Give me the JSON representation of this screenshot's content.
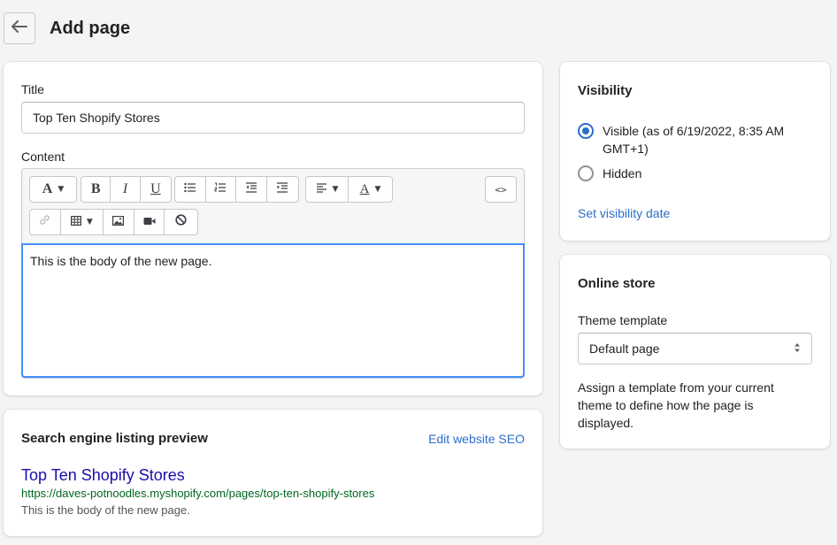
{
  "header": {
    "back_icon": "arrow-left-icon",
    "title": "Add page"
  },
  "page_form": {
    "title_label": "Title",
    "title_value": "Top Ten Shopify Stores",
    "content_label": "Content",
    "content_value": "This is the body of the new page.",
    "toolbar": {
      "row1": [
        {
          "group": "font",
          "items": [
            "text-style-icon"
          ],
          "caret": true
        },
        {
          "group": "format",
          "items": [
            "bold-icon",
            "italic-icon",
            "underline-icon"
          ]
        },
        {
          "group": "lists",
          "items": [
            "bulleted-list-icon",
            "numbered-list-icon",
            "outdent-icon",
            "indent-icon"
          ]
        },
        {
          "group": "align",
          "items": [
            "align-left-icon",
            "text-color-icon"
          ],
          "caret": true
        },
        {
          "group": "source",
          "items": [
            "html-source-icon"
          ]
        }
      ],
      "row2": [
        {
          "group": "insert",
          "items": [
            "link-icon",
            "table-icon",
            "image-icon",
            "video-icon",
            "clear-formatting-icon"
          ]
        }
      ],
      "glyphs": {
        "text_style": "A",
        "bold": "B",
        "italic": "I",
        "underline": "U",
        "text_color": "A",
        "html_source": "<>"
      }
    }
  },
  "seo": {
    "title": "Search engine listing preview",
    "edit_link": "Edit website SEO",
    "preview_title": "Top Ten Shopify Stores",
    "preview_url": "https://daves-potnoodles.myshopify.com/pages/top-ten-shopify-stores",
    "preview_description": "This is the body of the new page.",
    "colors": {
      "title": "#1a0dab",
      "url": "#006621",
      "description": "#545454"
    }
  },
  "visibility": {
    "title": "Visibility",
    "options": [
      {
        "label": "Visible (as of 6/19/2022, 8:35 AM GMT+1)",
        "checked": true
      },
      {
        "label": "Hidden",
        "checked": false
      }
    ],
    "set_date_link": "Set visibility date"
  },
  "online_store": {
    "title": "Online store",
    "template_label": "Theme template",
    "template_value": "Default page",
    "select_icon": "select-arrows-icon",
    "help_text": "Assign a template from your current theme to define how the page is displayed."
  },
  "colors": {
    "accent": "#2c6ecb",
    "focus": "#458fff",
    "background": "#f4f4f4"
  }
}
